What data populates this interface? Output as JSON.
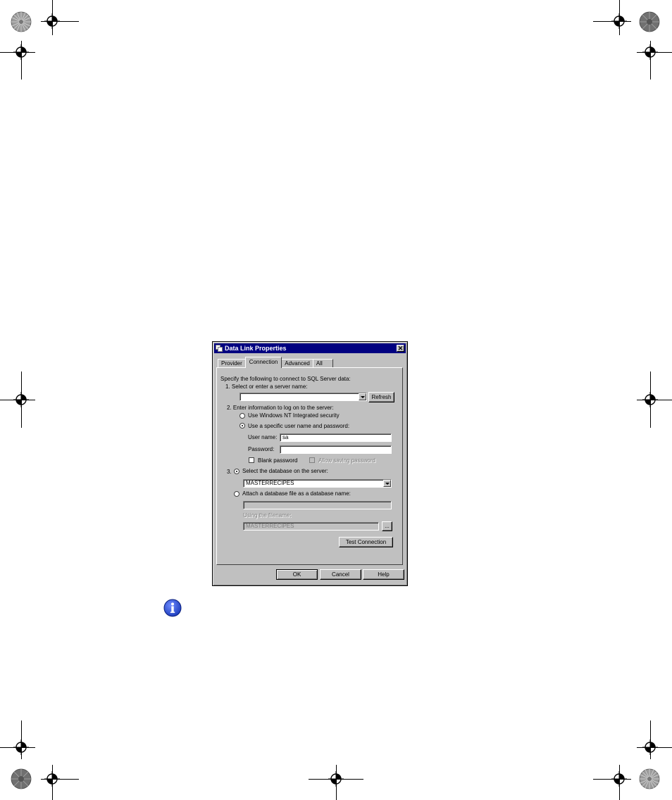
{
  "dialog": {
    "title": "Data Link Properties",
    "close_label": "✕",
    "tabs": [
      {
        "label": "Provider"
      },
      {
        "label": "Connection"
      },
      {
        "label": "Advanced"
      },
      {
        "label": "All"
      }
    ],
    "active_tab": "Connection",
    "intro": "Specify the following to connect to SQL Server data:",
    "step1": {
      "label": "1. Select or enter a server name:",
      "server_value": "",
      "refresh_label": "Refresh"
    },
    "step2": {
      "label": "2. Enter information to log on to the server:",
      "nt_security_label": "Use Windows NT Integrated security",
      "specific_user_label": "Use a specific user name and password:",
      "selected": "specific_user",
      "username_label": "User name:",
      "username_value": "sa",
      "password_label": "Password:",
      "password_value": "",
      "blank_password_label": "Blank password",
      "allow_saving_label": "Allow saving password"
    },
    "step3": {
      "number": "3.",
      "select_db_label": "Select the database on the server:",
      "database_value": "MASTERRECIPES",
      "attach_label": "Attach a database file as a database name:",
      "attach_value": "",
      "filename_label": "Using the filename:",
      "filename_value": "MASTERRECIPES",
      "browse_label": "...",
      "selected": "select_db"
    },
    "test_connection_label": "Test Connection",
    "ok_label": "OK",
    "cancel_label": "Cancel",
    "help_label": "Help"
  },
  "icons": {
    "info": "info-icon",
    "registration": "registration-mark-icon",
    "color_wheel": "color-wheel-icon"
  },
  "colors": {
    "titlebar": "#000080",
    "dialog_face": "#c0c0c0",
    "info_blue": "#1f3fbf"
  }
}
